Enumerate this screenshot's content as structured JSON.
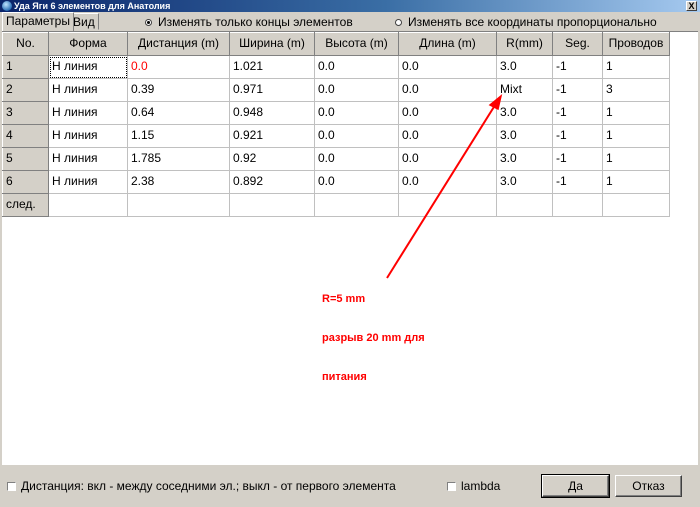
{
  "window": {
    "title": "Уда Яги 6 элементов для Анатолия",
    "close_label": "X"
  },
  "tabs": [
    {
      "label": "Параметры"
    },
    {
      "label": "Вид"
    }
  ],
  "options": {
    "radio_ends": "Изменять только концы элементов",
    "radio_proportional": "Изменять все координаты пропорционально",
    "selected": "radio_ends"
  },
  "table": {
    "headers": [
      "No.",
      "Форма",
      "Дистанция (m)",
      "Ширина (m)",
      "Высота (m)",
      "Длина (m)",
      "R(mm)",
      "Seg.",
      "Проводов"
    ],
    "rows": [
      [
        "1",
        "Н линия",
        "0.0",
        "1.021",
        "0.0",
        "0.0",
        "3.0",
        "-1",
        "1"
      ],
      [
        "2",
        "Н линия",
        "0.39",
        "0.971",
        "0.0",
        "0.0",
        "Mixt",
        "-1",
        "3"
      ],
      [
        "3",
        "Н линия",
        "0.64",
        "0.948",
        "0.0",
        "0.0",
        "3.0",
        "-1",
        "1"
      ],
      [
        "4",
        "Н линия",
        "1.15",
        "0.921",
        "0.0",
        "0.0",
        "3.0",
        "-1",
        "1"
      ],
      [
        "5",
        "Н линия",
        "1.785",
        "0.92",
        "0.0",
        "0.0",
        "3.0",
        "-1",
        "1"
      ],
      [
        "6",
        "Н линия",
        "2.38",
        "0.892",
        "0.0",
        "0.0",
        "3.0",
        "-1",
        "1"
      ],
      [
        "след.",
        "",
        "",
        "",
        "",
        "",
        "",
        "",
        ""
      ]
    ]
  },
  "annotation": {
    "lines": [
      "R=5 mm",
      "разрыв 20 mm для",
      "питания"
    ],
    "color": "#ff0000"
  },
  "footer": {
    "distance_checkbox": "Дистанция: вкл - между соседними эл.; выкл - от первого элемента",
    "lambda_checkbox": "lambda",
    "ok_button": "Да",
    "cancel_button": "Отказ"
  }
}
